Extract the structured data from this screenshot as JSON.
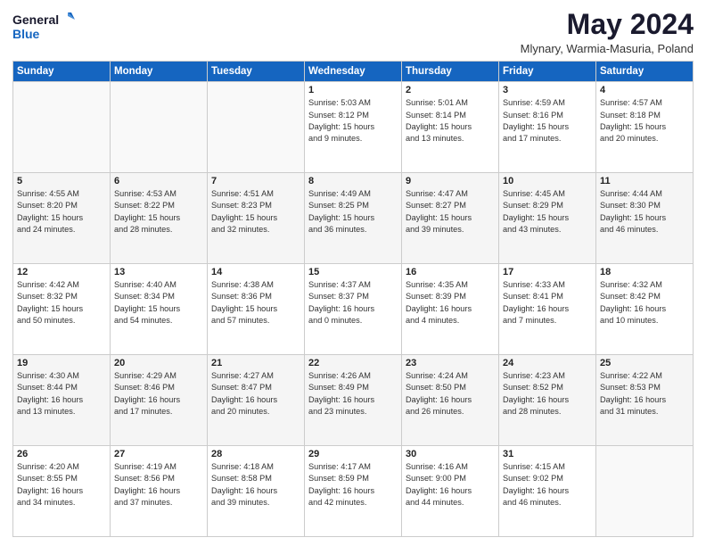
{
  "logo": {
    "line1": "General",
    "line2": "Blue",
    "icon_color": "#1565c0"
  },
  "header": {
    "month_year": "May 2024",
    "location": "Mlynary, Warmia-Masuria, Poland"
  },
  "days_of_week": [
    "Sunday",
    "Monday",
    "Tuesday",
    "Wednesday",
    "Thursday",
    "Friday",
    "Saturday"
  ],
  "weeks": [
    [
      {
        "day": "",
        "info": ""
      },
      {
        "day": "",
        "info": ""
      },
      {
        "day": "",
        "info": ""
      },
      {
        "day": "1",
        "info": "Sunrise: 5:03 AM\nSunset: 8:12 PM\nDaylight: 15 hours\nand 9 minutes."
      },
      {
        "day": "2",
        "info": "Sunrise: 5:01 AM\nSunset: 8:14 PM\nDaylight: 15 hours\nand 13 minutes."
      },
      {
        "day": "3",
        "info": "Sunrise: 4:59 AM\nSunset: 8:16 PM\nDaylight: 15 hours\nand 17 minutes."
      },
      {
        "day": "4",
        "info": "Sunrise: 4:57 AM\nSunset: 8:18 PM\nDaylight: 15 hours\nand 20 minutes."
      }
    ],
    [
      {
        "day": "5",
        "info": "Sunrise: 4:55 AM\nSunset: 8:20 PM\nDaylight: 15 hours\nand 24 minutes."
      },
      {
        "day": "6",
        "info": "Sunrise: 4:53 AM\nSunset: 8:22 PM\nDaylight: 15 hours\nand 28 minutes."
      },
      {
        "day": "7",
        "info": "Sunrise: 4:51 AM\nSunset: 8:23 PM\nDaylight: 15 hours\nand 32 minutes."
      },
      {
        "day": "8",
        "info": "Sunrise: 4:49 AM\nSunset: 8:25 PM\nDaylight: 15 hours\nand 36 minutes."
      },
      {
        "day": "9",
        "info": "Sunrise: 4:47 AM\nSunset: 8:27 PM\nDaylight: 15 hours\nand 39 minutes."
      },
      {
        "day": "10",
        "info": "Sunrise: 4:45 AM\nSunset: 8:29 PM\nDaylight: 15 hours\nand 43 minutes."
      },
      {
        "day": "11",
        "info": "Sunrise: 4:44 AM\nSunset: 8:30 PM\nDaylight: 15 hours\nand 46 minutes."
      }
    ],
    [
      {
        "day": "12",
        "info": "Sunrise: 4:42 AM\nSunset: 8:32 PM\nDaylight: 15 hours\nand 50 minutes."
      },
      {
        "day": "13",
        "info": "Sunrise: 4:40 AM\nSunset: 8:34 PM\nDaylight: 15 hours\nand 54 minutes."
      },
      {
        "day": "14",
        "info": "Sunrise: 4:38 AM\nSunset: 8:36 PM\nDaylight: 15 hours\nand 57 minutes."
      },
      {
        "day": "15",
        "info": "Sunrise: 4:37 AM\nSunset: 8:37 PM\nDaylight: 16 hours\nand 0 minutes."
      },
      {
        "day": "16",
        "info": "Sunrise: 4:35 AM\nSunset: 8:39 PM\nDaylight: 16 hours\nand 4 minutes."
      },
      {
        "day": "17",
        "info": "Sunrise: 4:33 AM\nSunset: 8:41 PM\nDaylight: 16 hours\nand 7 minutes."
      },
      {
        "day": "18",
        "info": "Sunrise: 4:32 AM\nSunset: 8:42 PM\nDaylight: 16 hours\nand 10 minutes."
      }
    ],
    [
      {
        "day": "19",
        "info": "Sunrise: 4:30 AM\nSunset: 8:44 PM\nDaylight: 16 hours\nand 13 minutes."
      },
      {
        "day": "20",
        "info": "Sunrise: 4:29 AM\nSunset: 8:46 PM\nDaylight: 16 hours\nand 17 minutes."
      },
      {
        "day": "21",
        "info": "Sunrise: 4:27 AM\nSunset: 8:47 PM\nDaylight: 16 hours\nand 20 minutes."
      },
      {
        "day": "22",
        "info": "Sunrise: 4:26 AM\nSunset: 8:49 PM\nDaylight: 16 hours\nand 23 minutes."
      },
      {
        "day": "23",
        "info": "Sunrise: 4:24 AM\nSunset: 8:50 PM\nDaylight: 16 hours\nand 26 minutes."
      },
      {
        "day": "24",
        "info": "Sunrise: 4:23 AM\nSunset: 8:52 PM\nDaylight: 16 hours\nand 28 minutes."
      },
      {
        "day": "25",
        "info": "Sunrise: 4:22 AM\nSunset: 8:53 PM\nDaylight: 16 hours\nand 31 minutes."
      }
    ],
    [
      {
        "day": "26",
        "info": "Sunrise: 4:20 AM\nSunset: 8:55 PM\nDaylight: 16 hours\nand 34 minutes."
      },
      {
        "day": "27",
        "info": "Sunrise: 4:19 AM\nSunset: 8:56 PM\nDaylight: 16 hours\nand 37 minutes."
      },
      {
        "day": "28",
        "info": "Sunrise: 4:18 AM\nSunset: 8:58 PM\nDaylight: 16 hours\nand 39 minutes."
      },
      {
        "day": "29",
        "info": "Sunrise: 4:17 AM\nSunset: 8:59 PM\nDaylight: 16 hours\nand 42 minutes."
      },
      {
        "day": "30",
        "info": "Sunrise: 4:16 AM\nSunset: 9:00 PM\nDaylight: 16 hours\nand 44 minutes."
      },
      {
        "day": "31",
        "info": "Sunrise: 4:15 AM\nSunset: 9:02 PM\nDaylight: 16 hours\nand 46 minutes."
      },
      {
        "day": "",
        "info": ""
      }
    ]
  ]
}
